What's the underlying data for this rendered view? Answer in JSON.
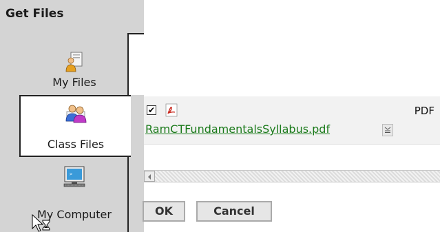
{
  "sidebar": {
    "title": "Get Files",
    "items": [
      {
        "label": "My Files",
        "icon": "folder-user-icon",
        "active": false
      },
      {
        "label": "Class Files",
        "icon": "users-group-icon",
        "active": true
      },
      {
        "label": "My Computer",
        "icon": "monitor-icon",
        "active": false
      }
    ]
  },
  "file_list": {
    "rows": [
      {
        "checked": true,
        "icon": "pdf-icon",
        "name": "RamCTFundamentalsSyllabus.pdf",
        "type": "PDF"
      }
    ]
  },
  "buttons": {
    "ok": "OK",
    "cancel": "Cancel"
  },
  "colors": {
    "sidebar_bg": "#d4d4d4",
    "link": "#1a7a1a",
    "active_tab_bg": "#ffffff"
  }
}
